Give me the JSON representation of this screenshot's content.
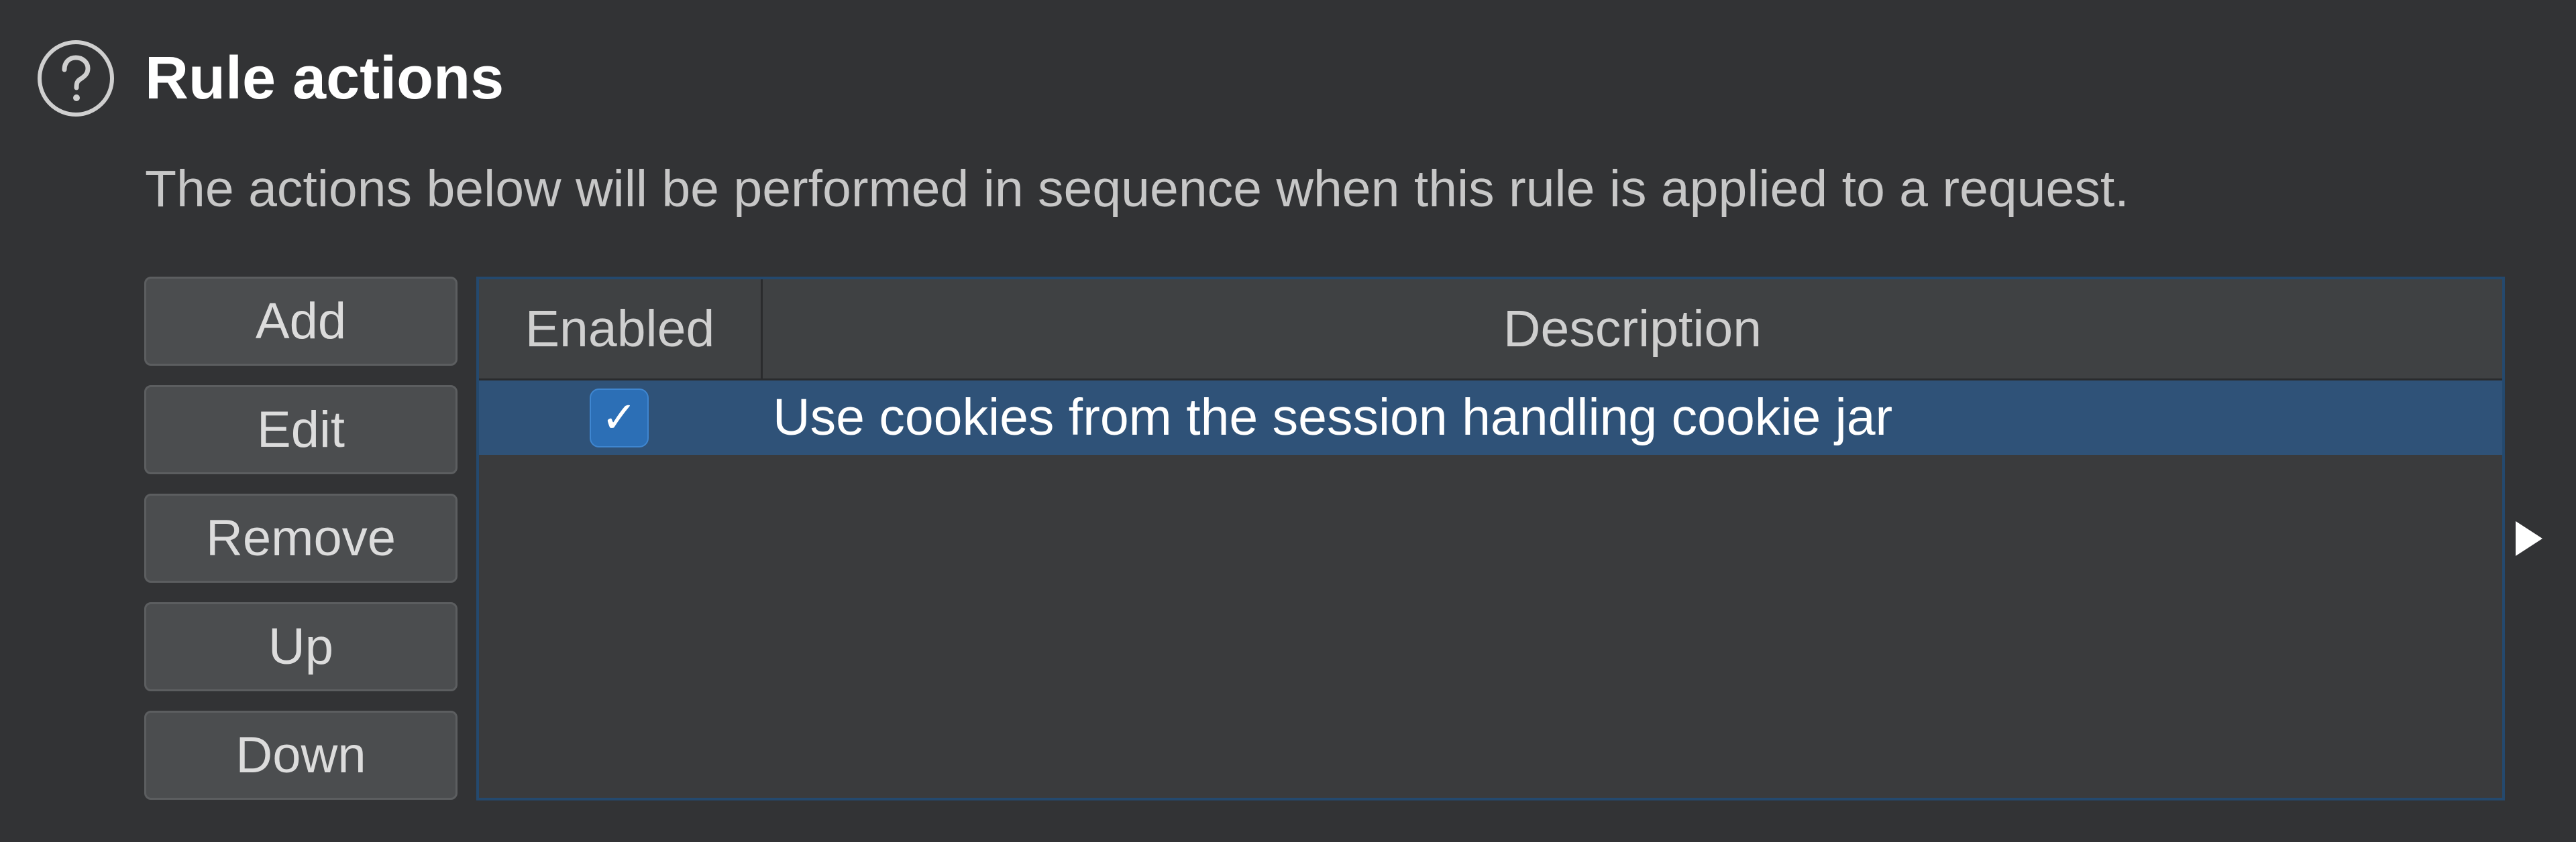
{
  "section": {
    "title": "Rule actions",
    "description": "The actions below will be performed in sequence when this rule is applied to a request.",
    "help_icon": "question-circle-icon"
  },
  "buttons": {
    "add": "Add",
    "edit": "Edit",
    "remove": "Remove",
    "up": "Up",
    "down": "Down"
  },
  "table": {
    "columns": [
      "Enabled",
      "Description"
    ],
    "rows": [
      {
        "enabled": true,
        "checkmark": "✓",
        "description": "Use cookies from the session handling cookie jar"
      }
    ]
  },
  "colors": {
    "background": "#323335",
    "selected_row": "#2f5278",
    "checkbox": "#2c6fb6",
    "table_border": "#24496e"
  },
  "icons": {
    "expand": "triangle-right-icon"
  }
}
